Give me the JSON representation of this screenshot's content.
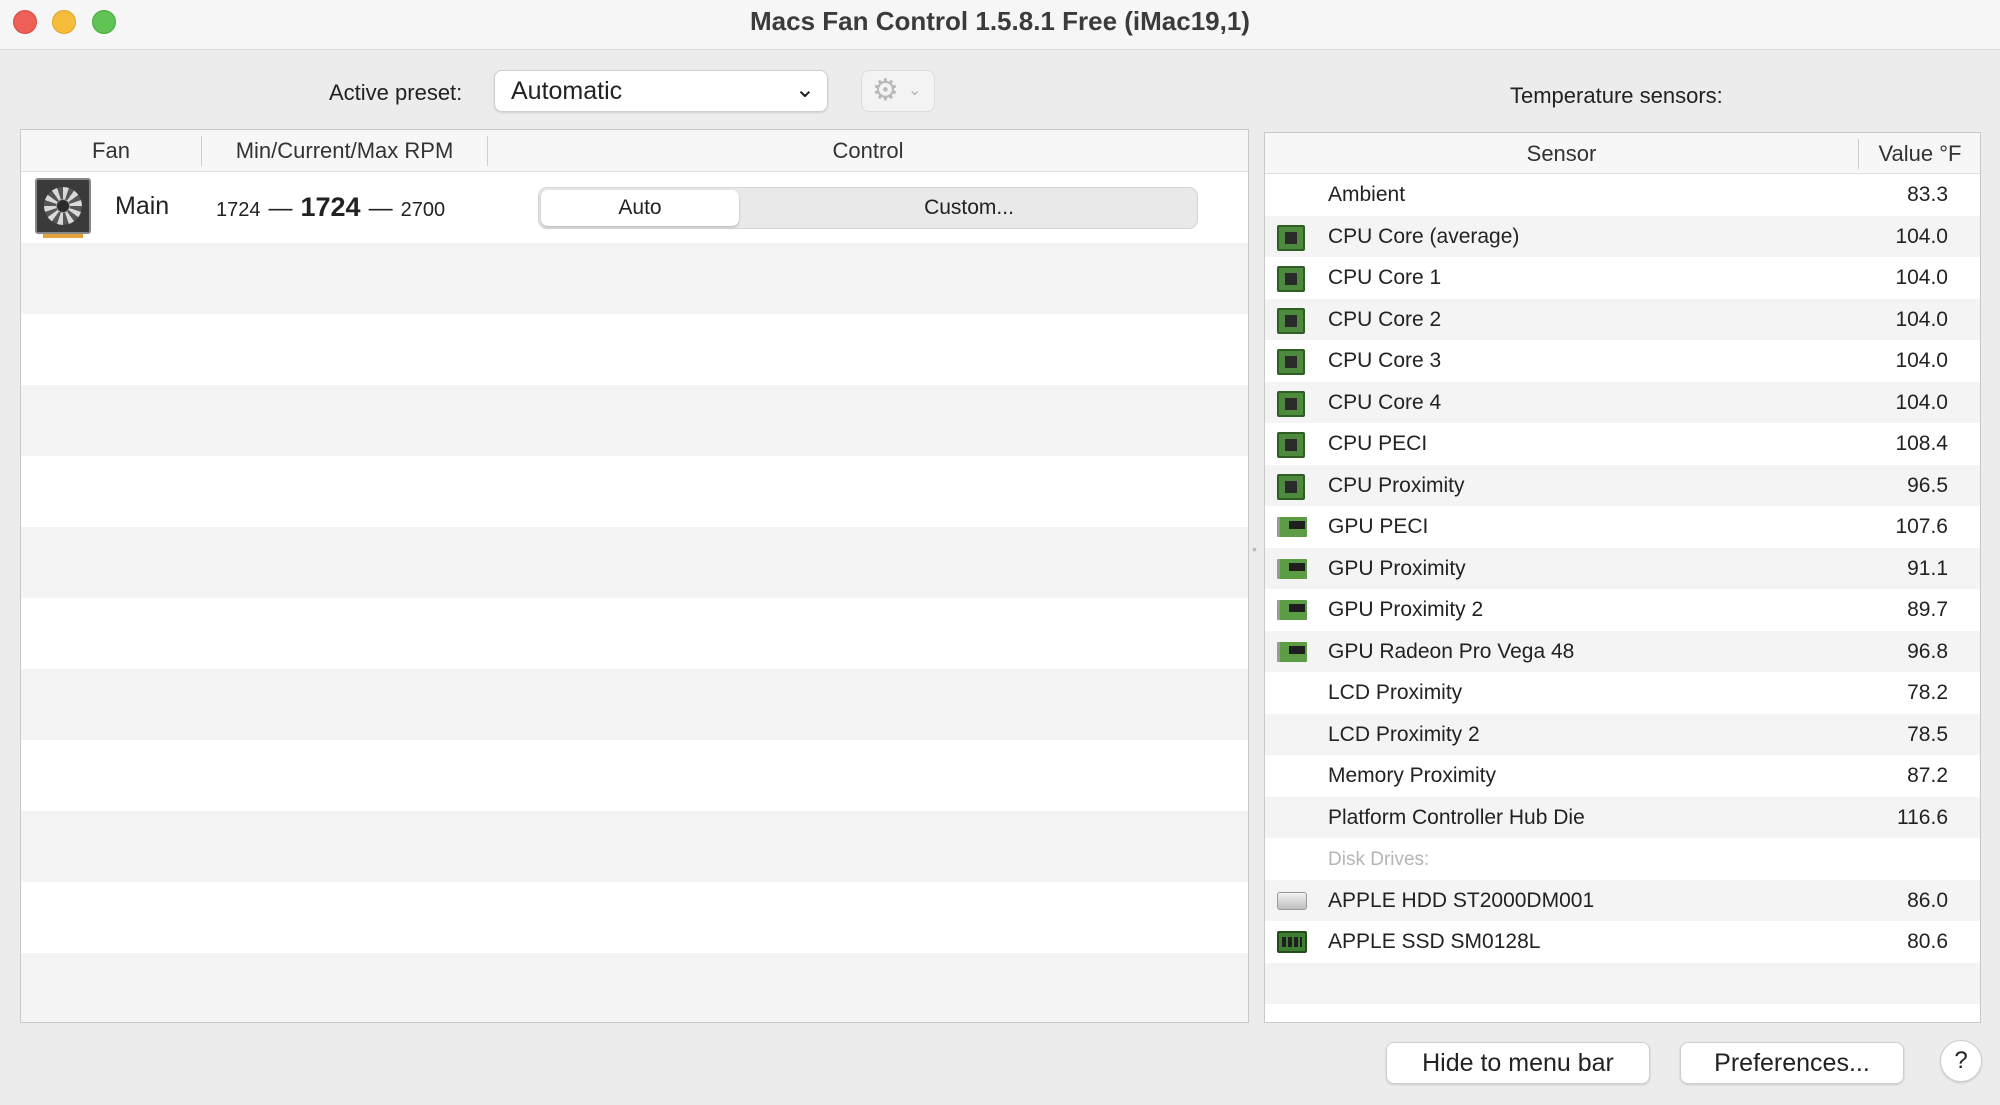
{
  "window": {
    "title": "Macs Fan Control 1.5.8.1 Free (iMac19,1)"
  },
  "preset": {
    "label": "Active preset:",
    "selected": "Automatic",
    "chevron": "⌄"
  },
  "fans": {
    "headers": [
      "Fan",
      "Min/Current/Max RPM",
      "Control"
    ],
    "rows": [
      {
        "name": "Main",
        "min_rpm": "1724",
        "current_rpm": "1724",
        "max_rpm": "2700",
        "control_auto": "Auto",
        "control_custom": "Custom...",
        "selected_control": "Auto"
      }
    ]
  },
  "sensors": {
    "section_label": "Temperature sensors:",
    "headers": [
      "Sensor",
      "Value °F"
    ],
    "rows": [
      {
        "name": "Ambient",
        "value": "83.3",
        "icon": "none"
      },
      {
        "name": "CPU Core (average)",
        "value": "104.0",
        "icon": "cpu-chip-icon"
      },
      {
        "name": "CPU Core 1",
        "value": "104.0",
        "icon": "cpu-chip-icon"
      },
      {
        "name": "CPU Core 2",
        "value": "104.0",
        "icon": "cpu-chip-icon"
      },
      {
        "name": "CPU Core 3",
        "value": "104.0",
        "icon": "cpu-chip-icon"
      },
      {
        "name": "CPU Core 4",
        "value": "104.0",
        "icon": "cpu-chip-icon"
      },
      {
        "name": "CPU PECI",
        "value": "108.4",
        "icon": "cpu-chip-icon"
      },
      {
        "name": "CPU Proximity",
        "value": "96.5",
        "icon": "cpu-chip-icon"
      },
      {
        "name": "GPU PECI",
        "value": "107.6",
        "icon": "gpu-card-icon"
      },
      {
        "name": "GPU Proximity",
        "value": "91.1",
        "icon": "gpu-card-icon"
      },
      {
        "name": "GPU Proximity 2",
        "value": "89.7",
        "icon": "gpu-card-icon"
      },
      {
        "name": "GPU Radeon Pro Vega 48",
        "value": "96.8",
        "icon": "gpu-card-icon"
      },
      {
        "name": "LCD Proximity",
        "value": "78.2",
        "icon": "none"
      },
      {
        "name": "LCD Proximity 2",
        "value": "78.5",
        "icon": "none"
      },
      {
        "name": "Memory Proximity",
        "value": "87.2",
        "icon": "none"
      },
      {
        "name": "Platform Controller Hub Die",
        "value": "116.6",
        "icon": "none"
      }
    ],
    "disk_section_label": "Disk Drives:",
    "disk_rows": [
      {
        "name": "APPLE HDD ST2000DM001",
        "value": "86.0",
        "icon": "hdd-drive-icon"
      },
      {
        "name": "APPLE SSD SM0128L",
        "value": "80.6",
        "icon": "ssd-drive-icon"
      }
    ]
  },
  "footer": {
    "hide_button": "Hide to menu bar",
    "preferences_button": "Preferences...",
    "help_button": "?"
  },
  "colors": {
    "close": "#ee5f57",
    "minimize": "#f6bd3b",
    "zoom": "#5fc454",
    "chip_green": "#4d8a3e"
  }
}
